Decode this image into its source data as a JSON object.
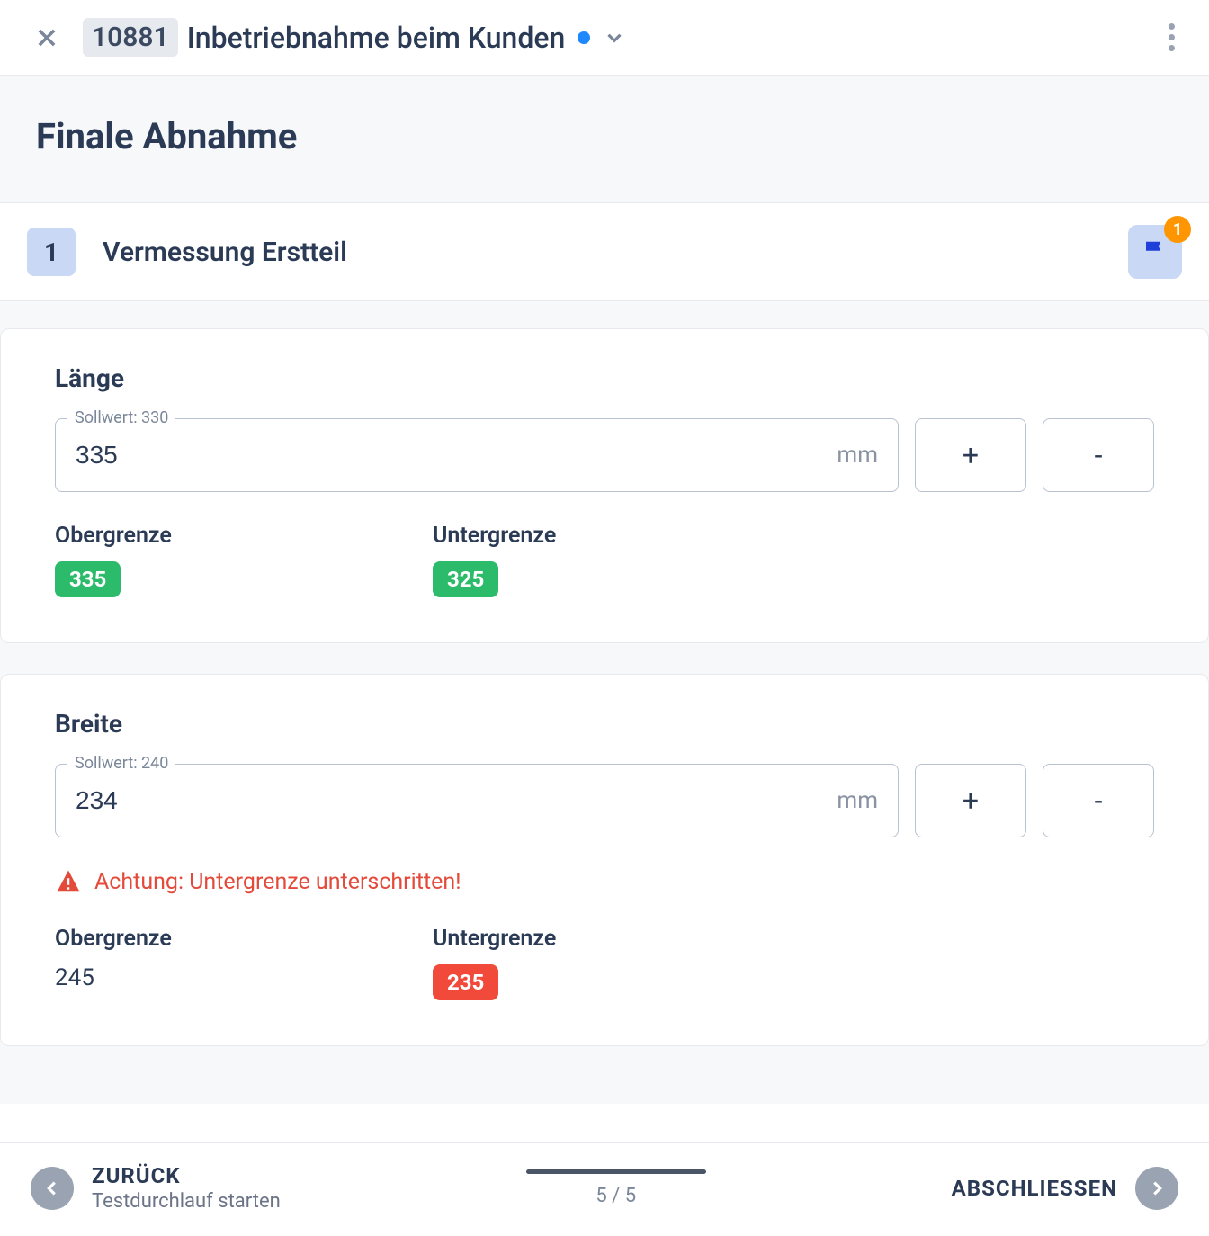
{
  "header": {
    "id": "10881",
    "title": "Inbetriebnahme beim Kunden"
  },
  "section": {
    "heading": "Finale Abnahme"
  },
  "step": {
    "number": "1",
    "title": "Vermessung Erstteil",
    "flag_badge": "1"
  },
  "measurements": [
    {
      "name": "Länge",
      "sollwert_label": "Sollwert: 330",
      "value": "335",
      "unit": "mm",
      "warning": null,
      "upper": {
        "label": "Obergrenze",
        "value": "335",
        "style": "green"
      },
      "lower": {
        "label": "Untergrenze",
        "value": "325",
        "style": "green"
      }
    },
    {
      "name": "Breite",
      "sollwert_label": "Sollwert: 240",
      "value": "234",
      "unit": "mm",
      "warning": "Achtung: Untergrenze unterschritten!",
      "upper": {
        "label": "Obergrenze",
        "value": "245",
        "style": "plain"
      },
      "lower": {
        "label": "Untergrenze",
        "value": "235",
        "style": "red"
      }
    }
  ],
  "footer": {
    "back_label": "ZURÜCK",
    "back_sub": "Testdurchlauf starten",
    "page_indicator": "5 / 5",
    "finish_label": "ABSCHLIESSEN"
  },
  "glyphs": {
    "plus": "+",
    "minus": "-"
  }
}
